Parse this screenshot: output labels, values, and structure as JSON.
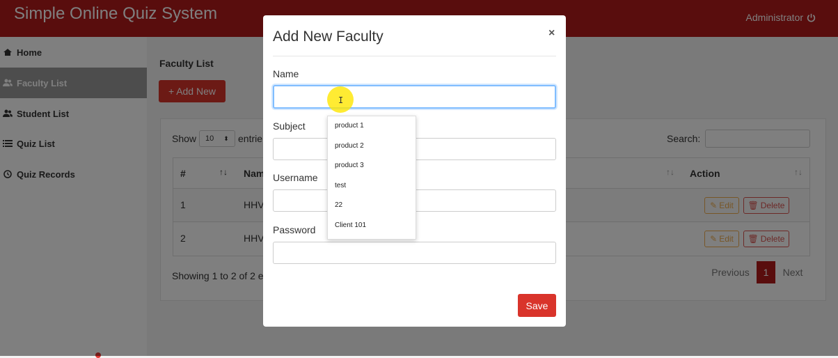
{
  "header": {
    "app_title": "Simple Online Quiz System",
    "user_label": "Administrator",
    "icon": "power-icon",
    "color": "#b31b1b"
  },
  "sidebar": {
    "items": [
      {
        "label": "Home",
        "icon": "home-icon"
      },
      {
        "label": "Faculty List",
        "icon": "users-icon",
        "active": true
      },
      {
        "label": "Student List",
        "icon": "users-icon"
      },
      {
        "label": "Quiz List",
        "icon": "list-icon"
      },
      {
        "label": "Quiz Records",
        "icon": "history-icon"
      }
    ]
  },
  "main": {
    "title": "Faculty List",
    "add_button": "Add New",
    "show_label": "Show",
    "page_size": "10",
    "entries_label": "entrie",
    "search_label": "Search:",
    "table": {
      "columns": [
        "#",
        "Nam",
        "Action"
      ],
      "rows": [
        {
          "num": "1",
          "name": "HHV",
          "edit": "Edit",
          "delete": "Delete"
        },
        {
          "num": "2",
          "name": "HHV",
          "edit": "Edit",
          "delete": "Delete"
        }
      ]
    },
    "showing_text": "Showing 1 to 2 of 2 e",
    "pagination": {
      "previous": "Previous",
      "current": "1",
      "next": "Next"
    }
  },
  "modal": {
    "title": "Add New Faculty",
    "close": "×",
    "fields": [
      {
        "label": "Name",
        "value": ""
      },
      {
        "label": "Subject",
        "value": ""
      },
      {
        "label": "Username",
        "value": ""
      },
      {
        "label": "Password",
        "value": ""
      }
    ],
    "save_label": "Save"
  },
  "autocomplete": {
    "items": [
      "product 1",
      "product 2",
      "product 3",
      "test",
      "22",
      "Client 101"
    ]
  }
}
